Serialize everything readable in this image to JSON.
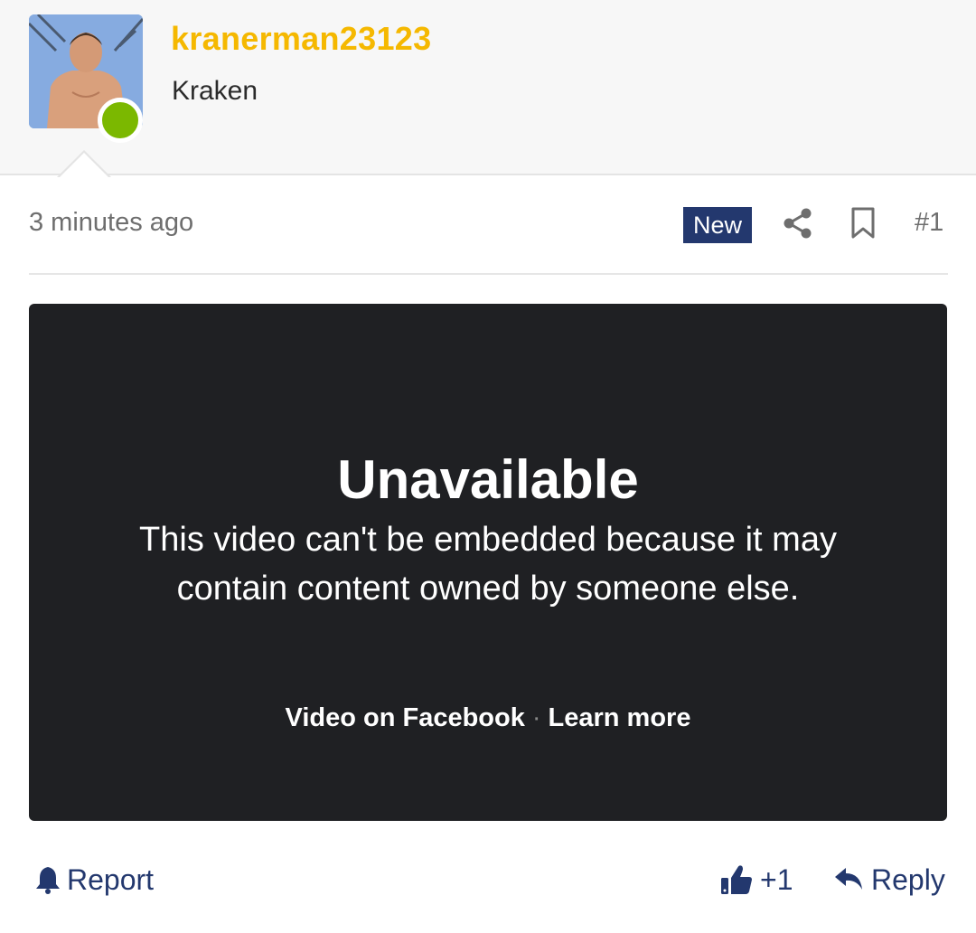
{
  "user": {
    "username": "kranerman23123",
    "title": "Kraken",
    "online": true
  },
  "meta": {
    "timestamp": "3 minutes ago",
    "badge": "New",
    "post_number": "#1"
  },
  "embed": {
    "title": "Unavailable",
    "message": "This video can't be embedded because it may contain content owned by someone else.",
    "link_video": "Video on Facebook",
    "separator": "·",
    "link_learn": "Learn more"
  },
  "actions": {
    "report_label": "Report",
    "like_count": "+1",
    "reply_label": "Reply"
  },
  "icons": {
    "report": "bell-icon",
    "like": "thumbs-up-icon",
    "reply": "reply-arrow-icon",
    "share": "share-icon",
    "bookmark": "bookmark-icon"
  },
  "colors": {
    "username": "#f5b800",
    "accent": "#23386e",
    "online": "#7bb800",
    "embed_bg": "#1f2023"
  }
}
